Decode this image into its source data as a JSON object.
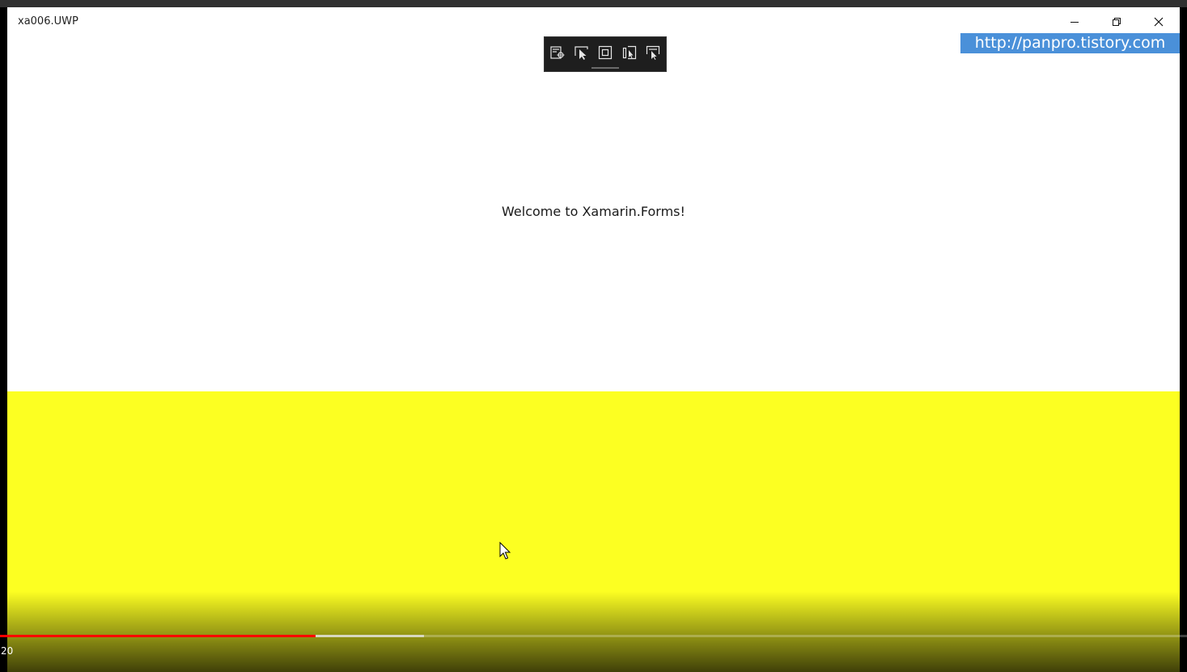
{
  "window": {
    "title": "xa006.UWP",
    "controls": {
      "minimize_icon": "minimize-icon",
      "restore_icon": "restore-icon",
      "close_icon": "close-icon"
    }
  },
  "watermark": {
    "text": "http://panpro.tistory.com",
    "color": "#4a90d9"
  },
  "debug_toolbar": {
    "tools": [
      {
        "icon": "live-visual-tree-icon"
      },
      {
        "icon": "select-element-icon"
      },
      {
        "icon": "display-layout-adorners-icon"
      },
      {
        "icon": "track-focus-icon"
      },
      {
        "icon": "hot-reload-select-icon"
      }
    ]
  },
  "content": {
    "welcome_text": "Welcome to Xamarin.Forms!",
    "bottom_panel_color": "#fcff22"
  },
  "player": {
    "time_text": "20",
    "played_fraction": 0.266,
    "buffered_fraction": 0.357,
    "played_color": "#ff0000"
  }
}
